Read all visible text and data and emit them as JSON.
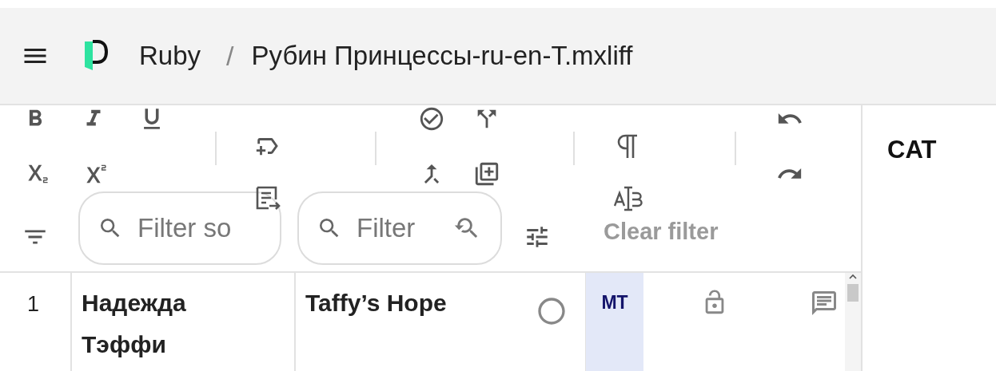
{
  "header": {
    "breadcrumb": [
      {
        "label": "Ruby"
      },
      {
        "label": "Рубин Принцессы-ru-en-T.mxliff"
      }
    ],
    "separator": "/"
  },
  "filters": {
    "source": {
      "placeholder": "Filter so"
    },
    "target": {
      "placeholder": "Filter"
    },
    "clear": {
      "label": "Clear filter",
      "disabled": true
    }
  },
  "side_panel": {
    "title": "CAT"
  },
  "segments": [
    {
      "number": "1",
      "source": "Надежда Тэффи",
      "target": "Taffy’s Hope",
      "confirmed": false,
      "match": "MT",
      "locked": false
    }
  ]
}
